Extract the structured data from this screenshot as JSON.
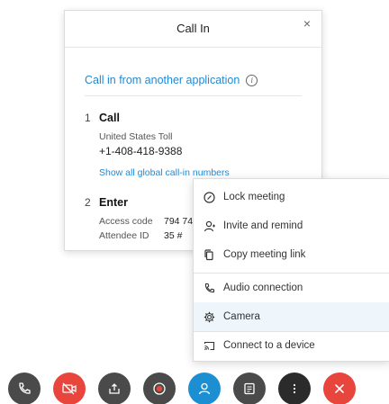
{
  "callin": {
    "title": "Call In",
    "close_glyph": "×",
    "app_link": "Call in from another application",
    "info_glyph": "i",
    "step1": {
      "number": "1",
      "label": "Call",
      "toll_label": "United States Toll",
      "toll_number": "+1-408-418-9388",
      "global_link": "Show all global call-in numbers"
    },
    "step2": {
      "number": "2",
      "label": "Enter",
      "access_code_label": "Access code",
      "access_code_value": "794 74",
      "attendee_id_label": "Attendee ID",
      "attendee_id_value": "35 #"
    }
  },
  "menu": {
    "items": [
      {
        "label": "Lock meeting",
        "icon": "lock-meeting-icon"
      },
      {
        "label": "Invite and remind",
        "icon": "invite-person-icon"
      },
      {
        "label": "Copy meeting link",
        "icon": "copy-link-icon"
      },
      {
        "label": "Audio connection",
        "icon": "phone-icon"
      },
      {
        "label": "Camera",
        "icon": "gear-icon",
        "selected": true
      },
      {
        "label": "Connect to a device",
        "icon": "cast-icon"
      }
    ]
  },
  "controls": [
    {
      "name": "audio-button",
      "icon": "phone-icon",
      "color": "#4a4a4a"
    },
    {
      "name": "video-button",
      "icon": "video-off-icon",
      "color": "#e8453c"
    },
    {
      "name": "share-button",
      "icon": "share-icon",
      "color": "#4a4a4a"
    },
    {
      "name": "record-button",
      "icon": "record-icon",
      "color": "#4a4a4a"
    },
    {
      "name": "participants-button",
      "icon": "participants-icon",
      "color": "#1c8fd3"
    },
    {
      "name": "chat-button",
      "icon": "chat-icon",
      "color": "#4a4a4a"
    },
    {
      "name": "more-options-button",
      "icon": "more-icon",
      "color": "#2b2b2b"
    },
    {
      "name": "leave-button",
      "icon": "close-icon",
      "color": "#e8453c"
    }
  ]
}
